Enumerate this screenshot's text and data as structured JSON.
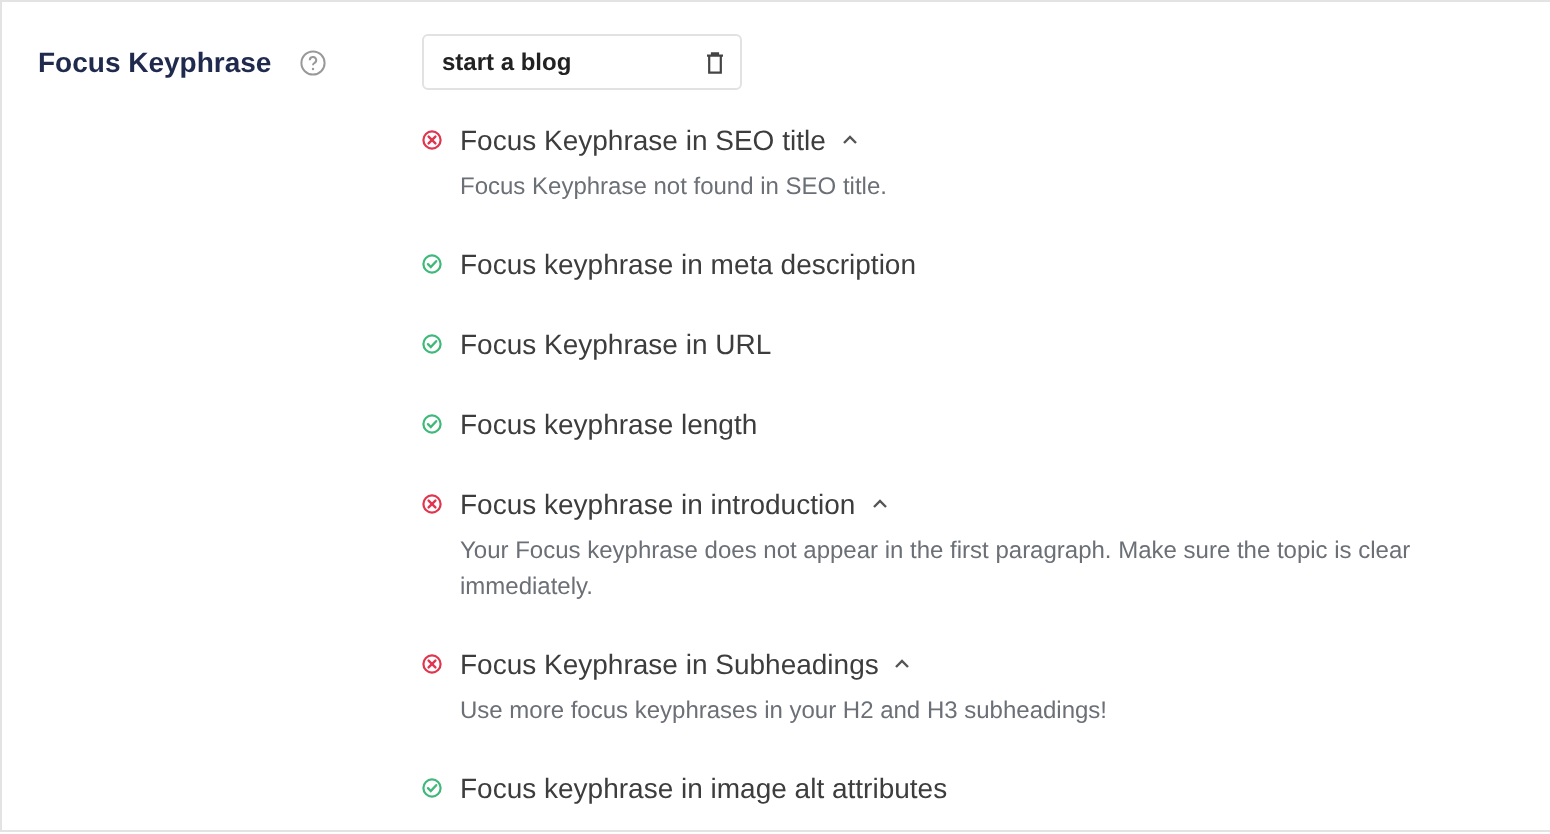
{
  "label": "Focus Keyphrase",
  "keyphrase_field": {
    "value": "start a blog"
  },
  "checks": [
    {
      "kind": "fail",
      "title": "Focus Keyphrase in SEO title",
      "expanded": true,
      "description": "Focus Keyphrase not found in SEO title."
    },
    {
      "kind": "pass",
      "title": "Focus keyphrase in meta description"
    },
    {
      "kind": "pass",
      "title": "Focus Keyphrase in URL"
    },
    {
      "kind": "pass",
      "title": "Focus keyphrase length"
    },
    {
      "kind": "fail",
      "title": "Focus keyphrase in introduction",
      "expanded": true,
      "description": "Your Focus keyphrase does not appear in the first paragraph. Make sure the topic is clear immediately."
    },
    {
      "kind": "fail",
      "title": "Focus Keyphrase in Subheadings",
      "expanded": true,
      "description": "Use more focus keyphrases in your H2 and H3 subheadings!"
    },
    {
      "kind": "pass",
      "title": "Focus keyphrase in image alt attributes"
    }
  ]
}
